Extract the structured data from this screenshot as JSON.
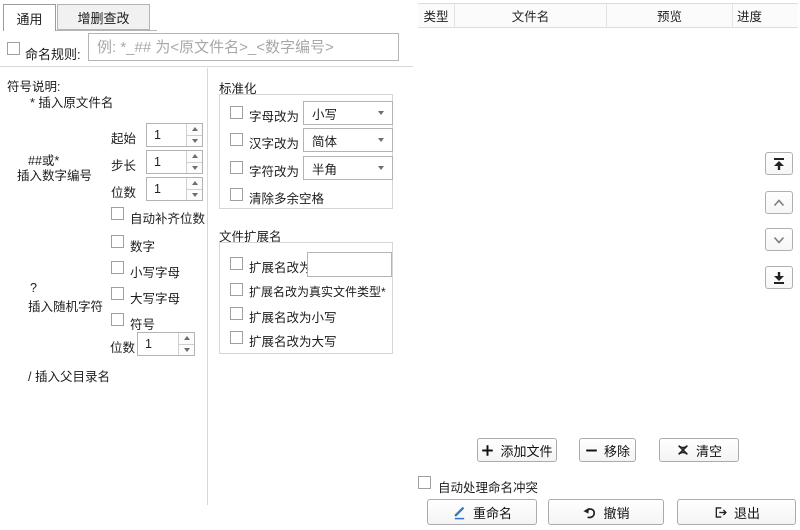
{
  "colors": {
    "pencil_blue": "#2e77c0",
    "icon_dark": "#222222"
  },
  "tabs": {
    "general": "通用",
    "edit": "增删查改"
  },
  "rule": {
    "label": "命名规则:",
    "placeholder": "例: *_## 为<原文件名>_<数字编号>"
  },
  "symbols": {
    "title": "符号说明:",
    "insert_original": "* 插入原文件名",
    "number_symbol": "##或*",
    "number_desc": "插入数字编号",
    "start_label": "起始",
    "start_value": "1",
    "step_label": "步长",
    "step_value": "1",
    "digits_label": "位数",
    "digits_value": "1",
    "auto_pad": "自动补齐位数",
    "random_symbol": "?",
    "random_desc": "插入随机字符",
    "opt_number": "数字",
    "opt_lower": "小写字母",
    "opt_upper": "大写字母",
    "opt_symbol": "符号",
    "rand_digits_label": "位数",
    "rand_digits_value": "1",
    "insert_parent": "/ 插入父目录名"
  },
  "normalize": {
    "title": "标准化",
    "letter_label": "字母改为",
    "letter_value": "小写",
    "hanzi_label": "汉字改为",
    "hanzi_value": "简体",
    "char_label": "字符改为",
    "char_value": "半角",
    "clear_spaces": "清除多余空格"
  },
  "extension": {
    "title": "文件扩展名",
    "change_label": "扩展名改为",
    "change_value": "",
    "real_type": "扩展名改为真实文件类型*",
    "to_lower": "扩展名改为小写",
    "to_upper": "扩展名改为大写"
  },
  "table": {
    "col_type": "类型",
    "col_filename": "文件名",
    "col_preview": "预览",
    "col_progress": "进度"
  },
  "actions": {
    "add": "添加文件",
    "remove": "移除",
    "clear": "清空",
    "conflict": "自动处理命名冲突",
    "rename": "重命名",
    "undo": "撤销",
    "exit": "退出"
  }
}
